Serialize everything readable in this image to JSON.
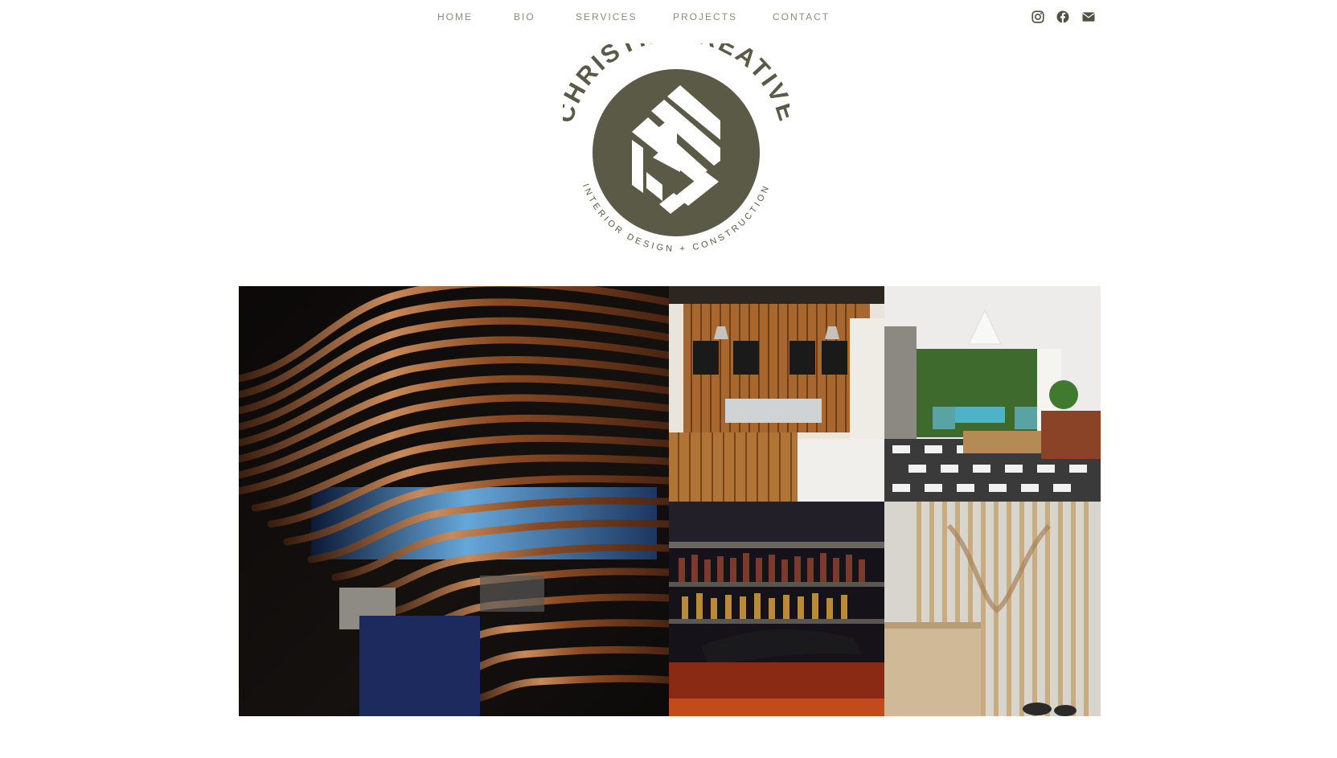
{
  "nav": {
    "items": [
      {
        "label": "HOME"
      },
      {
        "label": "BIO"
      },
      {
        "label": "SERVICES"
      },
      {
        "label": "PROJECTS"
      },
      {
        "label": "CONTACT"
      }
    ]
  },
  "social": {
    "icons": [
      "instagram-icon",
      "facebook-icon",
      "email-icon"
    ],
    "color": "#4f5240"
  },
  "logo": {
    "top_text": "CHRISTIE CREATIVE",
    "bottom_text": "INTERIOR DESIGN + CONSTRUCTION",
    "brand_color": "#5a5a47"
  },
  "gallery": {
    "tiles": [
      {
        "name": "curved-timber-slat-wall"
      },
      {
        "name": "cafe-counter"
      },
      {
        "name": "living-room-patterned-rug"
      },
      {
        "name": "bar-shelves"
      },
      {
        "name": "timber-batten-wall"
      }
    ]
  }
}
